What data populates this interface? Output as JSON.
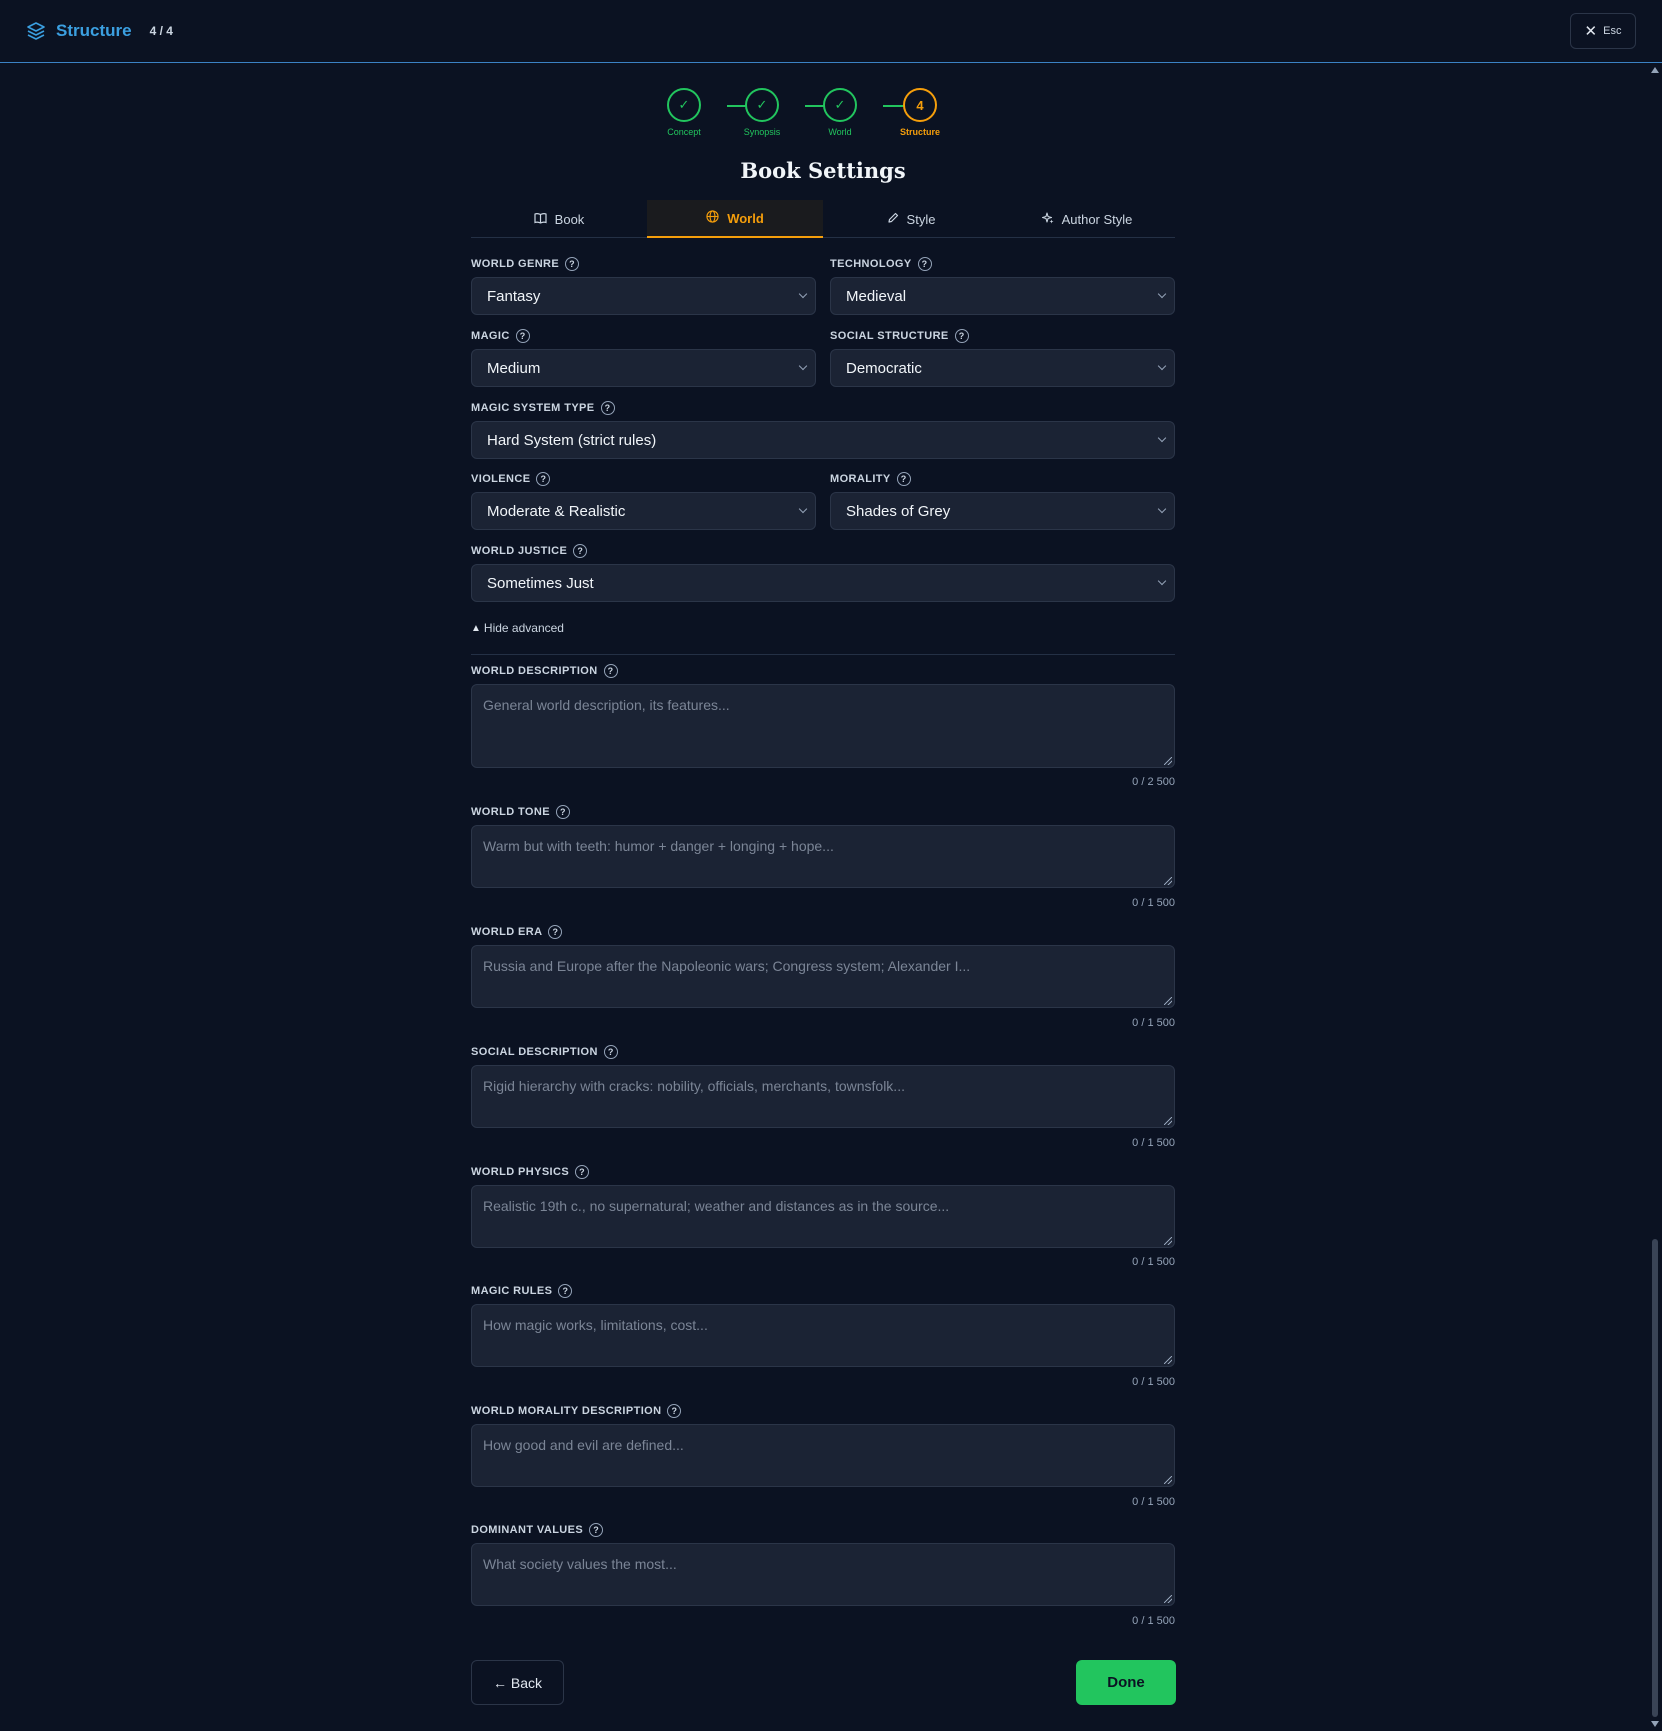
{
  "header": {
    "title": "Structure",
    "step_count": "4 / 4",
    "close_label": "Esc",
    "icon": "layers-icon"
  },
  "stepper": {
    "steps": [
      {
        "label": "Concept",
        "state": "done",
        "icon": "check-icon"
      },
      {
        "label": "Synopsis",
        "state": "done",
        "icon": "check-icon"
      },
      {
        "label": "World",
        "state": "done",
        "icon": "check-icon"
      },
      {
        "label": "Structure",
        "state": "active",
        "number": "4"
      }
    ]
  },
  "page": {
    "title": "Book Settings"
  },
  "tabs": [
    {
      "label": "Book",
      "icon": "book-icon"
    },
    {
      "label": "World",
      "icon": "globe-icon",
      "active": true
    },
    {
      "label": "Style",
      "icon": "pencil-icon"
    },
    {
      "label": "Author Style",
      "icon": "sparkles-icon"
    }
  ],
  "fields": {
    "world_genre": {
      "label": "WORLD GENRE",
      "value": "Fantasy"
    },
    "technology": {
      "label": "TECHNOLOGY",
      "value": "Medieval"
    },
    "magic": {
      "label": "MAGIC",
      "value": "Medium"
    },
    "social_structure": {
      "label": "SOCIAL STRUCTURE",
      "value": "Democratic"
    },
    "magic_system_type": {
      "label": "MAGIC SYSTEM TYPE",
      "value": "Hard System (strict rules)"
    },
    "violence": {
      "label": "VIOLENCE",
      "value": "Moderate & Realistic"
    },
    "morality": {
      "label": "MORALITY",
      "value": "Shades of Grey"
    },
    "world_justice": {
      "label": "WORLD JUSTICE",
      "value": "Sometimes Just"
    }
  },
  "advanced_toggle": "Hide advanced",
  "textareas": {
    "world_description": {
      "label": "WORLD DESCRIPTION",
      "placeholder": "General world description, its features...",
      "counter": "0 / 2 500"
    },
    "world_tone": {
      "label": "WORLD TONE",
      "placeholder": "Warm but with teeth: humor + danger + longing + hope...",
      "counter": "0 / 1 500"
    },
    "world_era": {
      "label": "WORLD ERA",
      "placeholder": "Russia and Europe after the Napoleonic wars; Congress system; Alexander I...",
      "counter": "0 / 1 500"
    },
    "social_description": {
      "label": "SOCIAL DESCRIPTION",
      "placeholder": "Rigid hierarchy with cracks: nobility, officials, merchants, townsfolk...",
      "counter": "0 / 1 500"
    },
    "world_physics": {
      "label": "WORLD PHYSICS",
      "placeholder": "Realistic 19th c., no supernatural; weather and distances as in the source...",
      "counter": "0 / 1 500"
    },
    "magic_rules": {
      "label": "MAGIC RULES",
      "placeholder": "How magic works, limitations, cost...",
      "counter": "0 / 1 500"
    },
    "world_morality_description": {
      "label": "WORLD MORALITY DESCRIPTION",
      "placeholder": "How good and evil are defined...",
      "counter": "0 / 1 500"
    },
    "dominant_values": {
      "label": "DOMINANT VALUES",
      "placeholder": "What society values the most...",
      "counter": "0 / 1 500"
    }
  },
  "help_glyph": "?",
  "footer": {
    "back_label": "← Back",
    "done_label": "Done"
  },
  "colors": {
    "accent": "#f59e0b",
    "success": "#22c55e",
    "brand": "#3b9fe0",
    "background": "#0b1222"
  }
}
